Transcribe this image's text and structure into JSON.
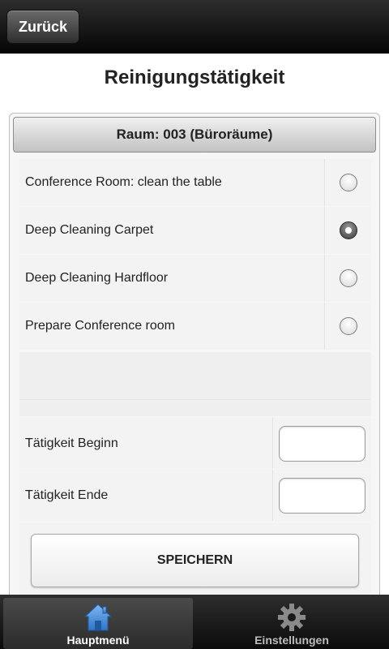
{
  "topbar": {
    "back_label": "Zurück"
  },
  "page": {
    "title": "Reinigungstätigkeit"
  },
  "room": {
    "header": "Raum: 003 (Büroräume)"
  },
  "tasks": [
    {
      "label": "Conference Room: clean the table",
      "checked": false
    },
    {
      "label": "Deep Cleaning Carpet",
      "checked": true
    },
    {
      "label": "Deep Cleaning Hardfloor",
      "checked": false
    },
    {
      "label": "Prepare Conference room",
      "checked": false
    }
  ],
  "times": {
    "start_label": "Tätigkeit Beginn",
    "start_value": "",
    "end_label": "Tätigkeit Ende",
    "end_value": ""
  },
  "actions": {
    "save_label": "SPEICHERN"
  },
  "tabbar": {
    "items": [
      {
        "label": "Hauptmenü",
        "icon": "home-icon",
        "active": true
      },
      {
        "label": "Einstellungen",
        "icon": "gear-icon",
        "active": false
      }
    ]
  },
  "colors": {
    "home_icon": "#4a90e2",
    "gear_icon": "#8a8a8a"
  }
}
